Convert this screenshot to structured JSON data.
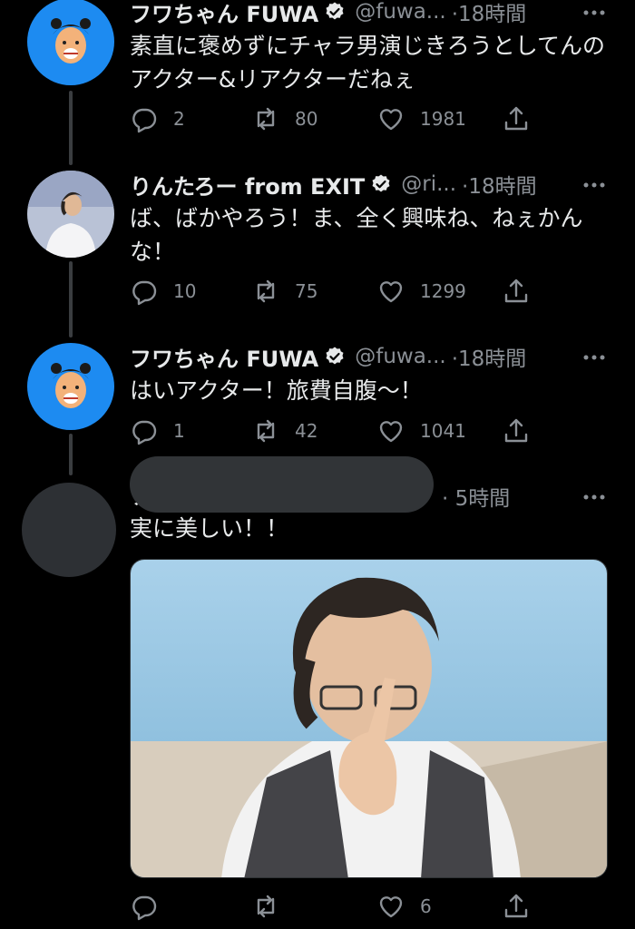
{
  "tweets": [
    {
      "name": "フワちゃん FUWA",
      "handle": "@fuwa...",
      "time": "·18時間",
      "text": "素直に褒めずにチャラ男演じきろうとしてんのアクター&リアクターだねぇ",
      "replies": "2",
      "retweets": "80",
      "likes": "1981",
      "verified": true
    },
    {
      "name": "りんたろー from EXIT",
      "handle": "@ri...",
      "time": "·18時間",
      "text": "ば、ばかやろう！ま、全く興味ね、ねぇかんな！",
      "replies": "10",
      "retweets": "75",
      "likes": "1299",
      "verified": true
    },
    {
      "name": "フワちゃん FUWA",
      "handle": "@fuwa...",
      "time": "·18時間",
      "text": "はいアクター！旅費自腹〜！",
      "replies": "1",
      "retweets": "42",
      "likes": "1041",
      "verified": true
    },
    {
      "name_fragment": "ソ",
      "time": "· 5時間",
      "text": "実に美しい！！",
      "replies": "",
      "retweets": "",
      "likes": "6"
    }
  ],
  "colors": {
    "background": "#000000",
    "text": "#e7e9ea",
    "secondary": "#8b9096",
    "verified": "#e7e9ea",
    "fuwa_avatar_bg": "#1d8bf1",
    "redaction": "#313437"
  },
  "icons": [
    "reply-icon",
    "retweet-icon",
    "like-icon",
    "share-icon",
    "more-icon",
    "verified-icon"
  ]
}
